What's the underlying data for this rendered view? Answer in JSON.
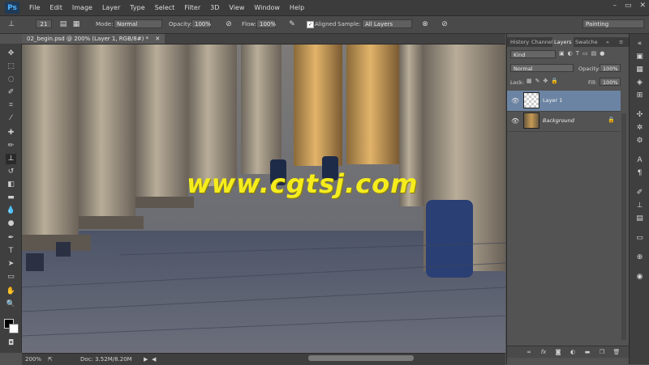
{
  "menu": {
    "logo": "Ps",
    "items": [
      "File",
      "Edit",
      "Image",
      "Layer",
      "Type",
      "Select",
      "Filter",
      "3D",
      "View",
      "Window",
      "Help"
    ],
    "window_controls": [
      "–",
      "▭",
      "✕"
    ]
  },
  "options": {
    "brush_size": "21",
    "mode_label": "Mode:",
    "mode_value": "Normal",
    "opacity_label": "Opacity:",
    "opacity_value": "100%",
    "flow_label": "Flow:",
    "flow_value": "100%",
    "aligned_label": "Aligned",
    "sample_label": "Sample:",
    "sample_value": "All Layers",
    "workspace_value": "Painting"
  },
  "document": {
    "tab_label": "02_begin.psd @ 200% (Layer 1, RGB/8#) *",
    "tab_close": "✕"
  },
  "watermark": "www.cgtsj.com",
  "status": {
    "zoom": "200%",
    "doc_info": "Doc: 3.52M/8.20M"
  },
  "panels": {
    "tabs": [
      "History",
      "Channel",
      "Layers",
      "Swatche"
    ],
    "active_tab": "Layers",
    "filter_kind": "Kind",
    "blend_mode": "Normal",
    "opacity_label": "Opacity:",
    "opacity_value": "100%",
    "lock_label": "Lock:",
    "fill_label": "Fill:",
    "fill_value": "100%",
    "layers": [
      {
        "name": "Layer 1",
        "selected": true
      },
      {
        "name": "Background",
        "selected": false
      }
    ],
    "footer_icons": [
      "link-icon",
      "fx-icon",
      "mask-icon",
      "adjustment-icon",
      "group-icon",
      "new-layer-icon",
      "trash-icon"
    ]
  },
  "colors": {
    "selected_layer": "#6c84a3",
    "watermark": "#f5ec1e",
    "logo_text": "#4fb3ff"
  }
}
